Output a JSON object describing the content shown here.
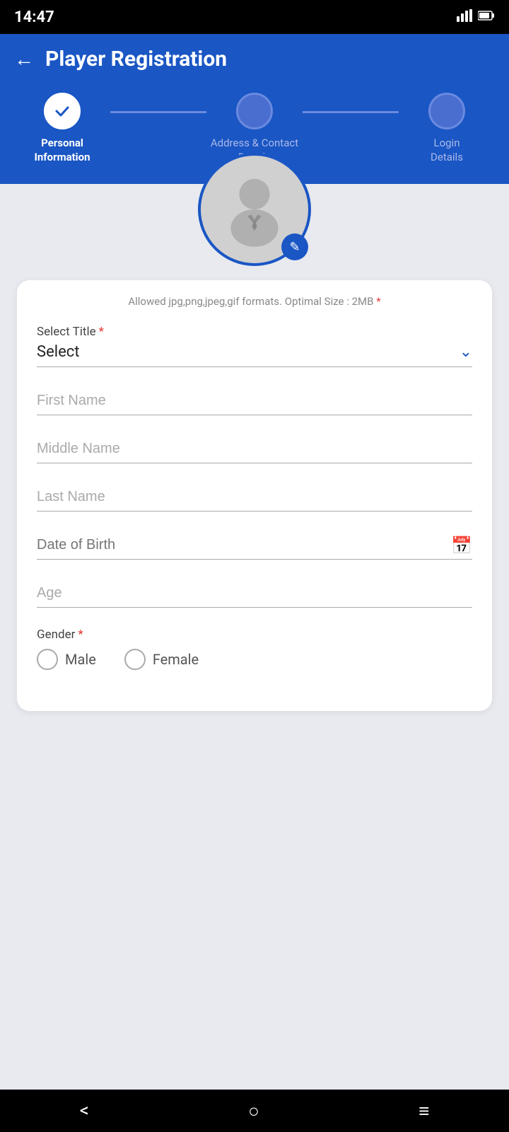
{
  "statusBar": {
    "time": "14:47",
    "icons": [
      "S",
      "✉",
      "G",
      "S",
      "WiFi",
      "Battery"
    ]
  },
  "header": {
    "backLabel": "←",
    "title": "Player Registration"
  },
  "steps": [
    {
      "id": "step-personal",
      "label": "Personal\nInformation",
      "state": "completed",
      "icon": "✓"
    },
    {
      "id": "step-address",
      "label": "Address & Contact\nDetails",
      "state": "active",
      "icon": ""
    },
    {
      "id": "step-login",
      "label": "Login\nDetails",
      "state": "inactive",
      "icon": ""
    }
  ],
  "avatar": {
    "editIconLabel": "✏"
  },
  "form": {
    "photoHint": "Allowed jpg,png,jpeg,gif formats. Optimal Size : 2MB",
    "photoHintRequired": "*",
    "fields": {
      "title": {
        "label": "Select Title",
        "required": true,
        "placeholder": "Select",
        "value": "Select"
      },
      "firstName": {
        "label": "First Name",
        "required": true,
        "placeholder": "First Name",
        "value": ""
      },
      "middleName": {
        "label": "Middle Name",
        "required": true,
        "placeholder": "Middle Name",
        "value": ""
      },
      "lastName": {
        "label": "Last Name",
        "required": true,
        "placeholder": "Last Name",
        "value": ""
      },
      "dateOfBirth": {
        "label": "Date of Birth",
        "required": true,
        "placeholder": "Date of Birth",
        "value": ""
      },
      "age": {
        "label": "Age",
        "required": false,
        "placeholder": "Age",
        "value": ""
      },
      "gender": {
        "label": "Gender",
        "required": true,
        "options": [
          {
            "value": "male",
            "label": "Male"
          },
          {
            "value": "female",
            "label": "Female"
          }
        ]
      }
    }
  },
  "bottomNav": {
    "back": "<",
    "home": "○",
    "menu": "≡"
  }
}
